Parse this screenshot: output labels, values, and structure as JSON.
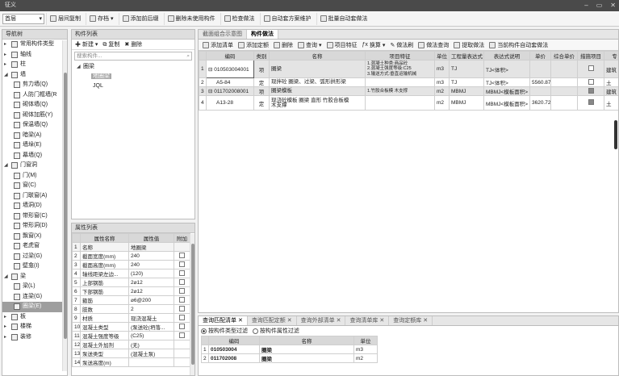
{
  "window": {
    "title": "征义",
    "controls": [
      "–",
      "▭",
      "✕"
    ]
  },
  "toolbar": {
    "selector": "首层",
    "buttons": [
      "层间复制",
      "存档",
      "添加前后缀",
      "删除未使用构件",
      "检查做法",
      "自动套方案维护",
      "批量自动套做法"
    ]
  },
  "nav": {
    "title": "导航树",
    "items": [
      {
        "label": "常用构件类型",
        "level": 0,
        "kind": "group"
      },
      {
        "label": "轴线",
        "level": 0,
        "kind": "group"
      },
      {
        "label": "柱",
        "level": 0,
        "kind": "group"
      },
      {
        "label": "墙",
        "level": 0,
        "kind": "group-open"
      },
      {
        "label": "剪力墙(Q)",
        "level": 1
      },
      {
        "label": "人防门框墙(R",
        "level": 1
      },
      {
        "label": "砌体墙(Q)",
        "level": 1
      },
      {
        "label": "砌体加筋(Y)",
        "level": 1
      },
      {
        "label": "保温墙(Q)",
        "level": 1
      },
      {
        "label": "暗梁(A)",
        "level": 1
      },
      {
        "label": "墙垛(E)",
        "level": 1
      },
      {
        "label": "幕墙(Q)",
        "level": 1
      },
      {
        "label": "门窗洞",
        "level": 0,
        "kind": "group-open"
      },
      {
        "label": "门(M)",
        "level": 1
      },
      {
        "label": "窗(C)",
        "level": 1
      },
      {
        "label": "门联窗(A)",
        "level": 1
      },
      {
        "label": "墙洞(D)",
        "level": 1
      },
      {
        "label": "带形窗(C)",
        "level": 1
      },
      {
        "label": "带形洞(D)",
        "level": 1
      },
      {
        "label": "飘窗(X)",
        "level": 1
      },
      {
        "label": "老虎窗",
        "level": 1
      },
      {
        "label": "过梁(G)",
        "level": 1
      },
      {
        "label": "壁龛(I)",
        "level": 1
      },
      {
        "label": "梁",
        "level": 0,
        "kind": "group-open"
      },
      {
        "label": "梁(L)",
        "level": 1
      },
      {
        "label": "连梁(G)",
        "level": 1
      },
      {
        "label": "圈梁(E)",
        "level": 1,
        "selected": true
      },
      {
        "label": "板",
        "level": 0,
        "kind": "group"
      },
      {
        "label": "楼梯",
        "level": 0,
        "kind": "group"
      },
      {
        "label": "装修",
        "level": 0,
        "kind": "group"
      }
    ]
  },
  "component_list": {
    "title": "构件列表",
    "actions": [
      "新建",
      "复制",
      "删除"
    ],
    "search_placeholder": "搜索构件...",
    "tree_root": "圈梁",
    "tree_items": [
      "地圈梁",
      "JQL"
    ]
  },
  "properties": {
    "title": "属性列表",
    "headers": [
      "属性名称",
      "属性值",
      "附加"
    ],
    "rows": [
      [
        "1",
        "名称",
        "地圈梁",
        ""
      ],
      [
        "2",
        "截面宽度(mm)",
        "240",
        "box"
      ],
      [
        "3",
        "截面高度(mm)",
        "240",
        "box"
      ],
      [
        "4",
        "轴线距梁左边...",
        "(120)",
        "box"
      ],
      [
        "5",
        "上部钢筋",
        "2⌀12",
        "box"
      ],
      [
        "6",
        "下部钢筋",
        "2⌀12",
        "box"
      ],
      [
        "7",
        "箍筋",
        "⌀6@200",
        "box"
      ],
      [
        "8",
        "肢数",
        "2",
        "box"
      ],
      [
        "9",
        "材质",
        "现浇混凝土",
        "box"
      ],
      [
        "10",
        "混凝土类型",
        "(泵送砼(坍落...",
        "box"
      ],
      [
        "11",
        "混凝土强度等级",
        "(C25)",
        "box"
      ],
      [
        "12",
        "混凝土外加剂",
        "(无)",
        ""
      ],
      [
        "13",
        "泵送类型",
        "(混凝土泵)",
        ""
      ],
      [
        "14",
        "泵送高度(m)",
        "",
        ""
      ]
    ]
  },
  "main": {
    "tabs": [
      "截面组合示意图",
      "构件做法"
    ],
    "active_tab": 1,
    "actions": [
      "添加清单",
      "添加定额",
      "删除",
      "查询",
      "项目特征",
      "换算",
      "做法刷",
      "做法查询",
      "提取做法",
      "当前构件自动套做法"
    ],
    "headers": [
      "编码",
      "类别",
      "名称",
      "项目特征",
      "单位",
      "工程量表达式",
      "表达式说明",
      "单价",
      "综合单价",
      "措施项目",
      "专"
    ],
    "rows": [
      {
        "num": "1",
        "code": "010503004001",
        "cat": "项",
        "name": "圈梁",
        "feature": "1.混凝土种类:商品砼\n2.混凝土强度等级:C25\n3.输送方式:垂直运输机械",
        "unit": "m3",
        "expr": "TJ",
        "desc": "TJ<体积>",
        "price": "",
        "uprice": "",
        "measure": false,
        "extra": "建筑",
        "group": true
      },
      {
        "num": "2",
        "code": "A5-84",
        "cat": "定",
        "name": "现拌砼 圈梁、过梁、弧形拱形梁",
        "feature": "",
        "unit": "m3",
        "expr": "TJ",
        "desc": "TJ<体积>",
        "price": "5560.87",
        "uprice": "",
        "measure": false,
        "extra": "土",
        "group": false
      },
      {
        "num": "3",
        "code": "011702008001",
        "cat": "项",
        "name": "圈梁模板",
        "feature": "1.竹胶合板模 木支撑",
        "unit": "m2",
        "expr": "MBMJ",
        "desc": "MBMJ<模板面积>",
        "price": "",
        "uprice": "",
        "measure": true,
        "extra": "建筑",
        "group": true
      },
      {
        "num": "4",
        "code": "A13-28",
        "cat": "定",
        "name": "现浇砼模板 圈梁 直形 竹胶合板模\n木支撑",
        "feature": "",
        "unit": "m2",
        "expr": "MBMJ",
        "desc": "MBMJ<模板面积>",
        "price": "3620.72",
        "uprice": "",
        "measure": true,
        "extra": "土",
        "group": false
      }
    ]
  },
  "bottom": {
    "tabs": [
      "查询匹配清单",
      "查询匹配定额",
      "查询外部清单",
      "查询清单库",
      "查询定额库"
    ],
    "filter_options": [
      "按构件类型过滤",
      "按构件属性过滤"
    ],
    "headers": [
      "编码",
      "名称",
      "单位"
    ],
    "rows": [
      [
        "1",
        "010503004",
        "圈梁",
        "m3"
      ],
      [
        "2",
        "011702008",
        "圈梁",
        "m2"
      ]
    ]
  }
}
